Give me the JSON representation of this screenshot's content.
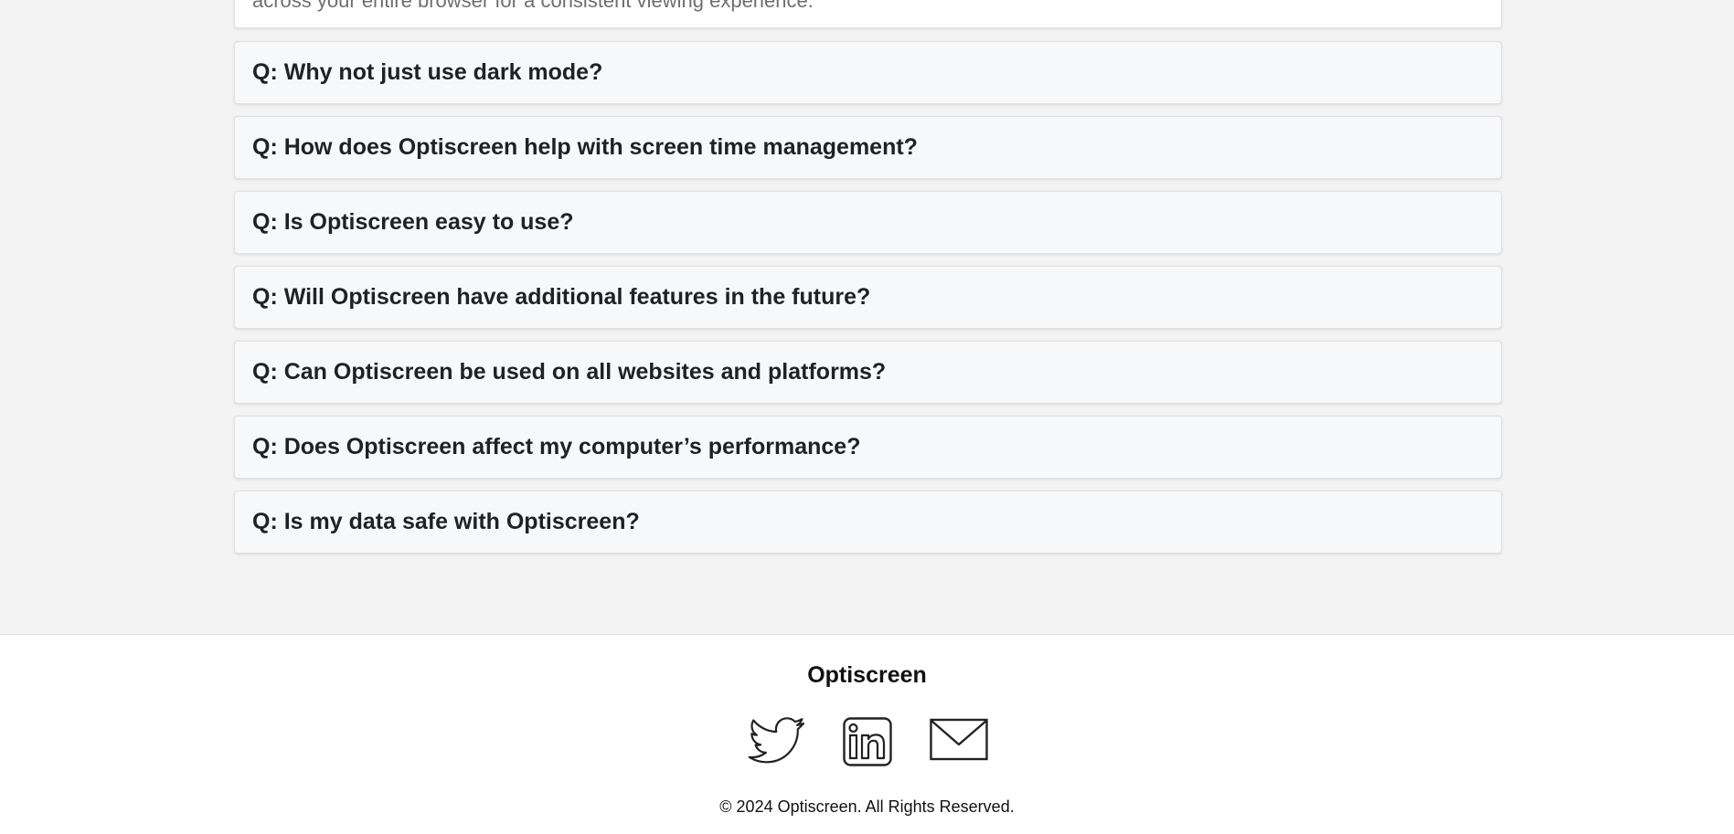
{
  "faq": {
    "open_item": {
      "answer_partial": "across your entire browser for a consistent viewing experience."
    },
    "items": [
      {
        "question": "Q: Why not just use dark mode?"
      },
      {
        "question": "Q: How does Optiscreen help with screen time management?"
      },
      {
        "question": "Q: Is Optiscreen easy to use?"
      },
      {
        "question": "Q: Will Optiscreen have additional features in the future?"
      },
      {
        "question": "Q: Can Optiscreen be used on all websites and platforms?"
      },
      {
        "question": "Q: Does Optiscreen affect my computer’s performance?"
      },
      {
        "question": "Q: Is my data safe with Optiscreen?"
      }
    ]
  },
  "footer": {
    "brand": "Optiscreen",
    "social": [
      {
        "icon": "twitter-icon"
      },
      {
        "icon": "linkedin-icon"
      },
      {
        "icon": "mail-icon"
      }
    ],
    "copyright": "© 2024 Optiscreen. All Rights Reserved."
  }
}
